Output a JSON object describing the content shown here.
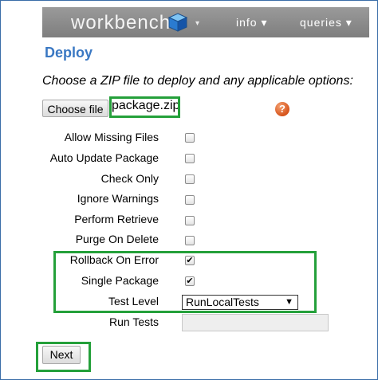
{
  "navbar": {
    "brand": "workbench",
    "brand_caret": "▾",
    "menus": [
      {
        "label": "info ▾"
      },
      {
        "label": "queries ▾"
      }
    ]
  },
  "page": {
    "title": "Deploy",
    "instructions": "Choose a ZIP file to deploy and any applicable options:"
  },
  "file": {
    "choose_label": "Choose file",
    "selected_name": "package.zip",
    "help_symbol": "?"
  },
  "options": [
    {
      "label": "Allow Missing Files",
      "checked": false
    },
    {
      "label": "Auto Update Package",
      "checked": false
    },
    {
      "label": "Check Only",
      "checked": false
    },
    {
      "label": "Ignore Warnings",
      "checked": false
    },
    {
      "label": "Perform Retrieve",
      "checked": false
    },
    {
      "label": "Purge On Delete",
      "checked": false
    },
    {
      "label": "Rollback On Error",
      "checked": true
    },
    {
      "label": "Single Package",
      "checked": true
    }
  ],
  "test_level": {
    "label": "Test Level",
    "selected": "RunLocalTests"
  },
  "run_tests": {
    "label": "Run Tests",
    "value": ""
  },
  "actions": {
    "next_label": "Next"
  },
  "colors": {
    "accent": "#3a78c3",
    "highlight_box": "#24a03a",
    "navbar": "#8a8a8a",
    "help_icon": "#d6541c"
  },
  "icons": {
    "brand": "workbench-cube-icon",
    "help": "help-icon",
    "dropdown": "chevron-down-icon"
  }
}
